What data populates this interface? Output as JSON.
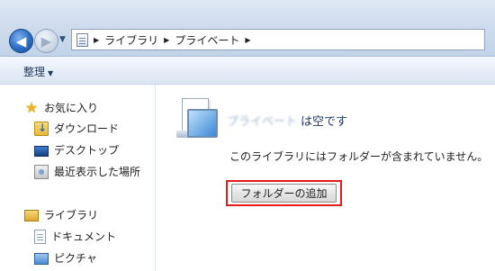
{
  "address_bar": {
    "breadcrumbs": [
      "ライブラリ",
      "プライベート"
    ]
  },
  "command_bar": {
    "organize_label": "整理"
  },
  "nav_pane": {
    "favorites": {
      "label": "お気に入り",
      "items": [
        "ダウンロード",
        "デスクトップ",
        "最近表示した場所"
      ]
    },
    "libraries": {
      "label": "ライブラリ",
      "items": [
        "ドキュメント",
        "ピクチャ"
      ]
    }
  },
  "content": {
    "library_name": "プライベート",
    "empty_title_suffix": "は空です",
    "empty_message": "このライブラリにはフォルダーが含まれていません。",
    "add_folder_label": "フォルダーの追加"
  },
  "colors": {
    "highlight_border": "#e31b1b",
    "accent": "#1e3a68"
  }
}
